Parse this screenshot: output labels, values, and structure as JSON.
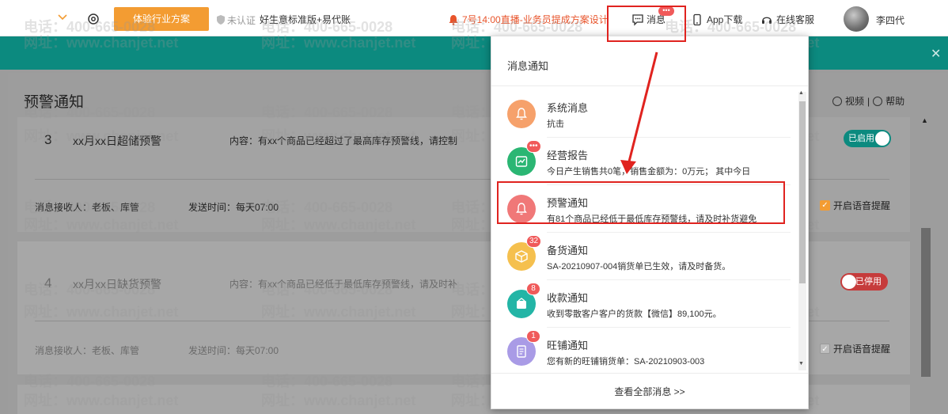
{
  "topbar": {
    "trial_button": "体验行业方案",
    "cert_label": "未认证",
    "edition": "好生意标准版+易代账",
    "live_notice": "7号14:00直播-业务员提成方案设计",
    "message_label": "消息",
    "message_badge": "•••",
    "app_label": "App下载",
    "service_label": "在线客服",
    "user_name": "李四代"
  },
  "page": {
    "title": "预警通知",
    "video_link": "视频",
    "help_link": "帮助"
  },
  "rules": [
    {
      "num": "3",
      "title": "xx月xx日超储预警",
      "content": "内容：有xx个商品已经超过了最高库存预警线，请控制",
      "receivers": "消息接收人：老板、库管",
      "send_time": "发送时间：每天07:00",
      "toggle": "已启用",
      "voice": "开启语音提醒"
    },
    {
      "num": "4",
      "title": "xx月xx日缺货预警",
      "content": "内容：有xx个商品已经低于最低库存预警线，请及时补",
      "receivers": "消息接收人：老板、库管",
      "send_time": "发送时间：每天07:00",
      "toggle": "已停用",
      "voice": "开启语音提醒"
    }
  ],
  "panel": {
    "title": "消息通知",
    "footer": "查看全部消息 >>",
    "items": [
      {
        "title": "系统消息",
        "desc": "抗击",
        "badge": "",
        "color": "#f6a16b",
        "icon": "bell-icon"
      },
      {
        "title": "经营报告",
        "desc": "今日产生销售共0笔，销售金额为：0万元； 其中今日",
        "badge": "•••",
        "color": "#2bb673",
        "icon": "report-icon"
      },
      {
        "title": "预警通知",
        "desc": "有81个商品已经低于最低库存预警线，请及时补货避免",
        "badge": "",
        "color": "#f07878",
        "icon": "bell-icon"
      },
      {
        "title": "备货通知",
        "desc": "SA-20210907-004销货单已生效，请及时备货。",
        "badge": "32",
        "color": "#f5c04e",
        "icon": "box-icon"
      },
      {
        "title": "收款通知",
        "desc": "收到零散客户客户的货款【微信】89,100元。",
        "badge": "8",
        "color": "#23b5a6",
        "icon": "wallet-icon"
      },
      {
        "title": "旺铺通知",
        "desc": "您有新的旺铺销货单：SA-20210903-003",
        "badge": "1",
        "color": "#a99be6",
        "icon": "document-icon"
      }
    ]
  },
  "watermark": {
    "phone": "电话：400-665-0028",
    "site": "网址：www.chanjet.net"
  },
  "colors": {
    "accent_orange": "#f39c32",
    "teal": "#0c8a7f",
    "alert_red": "#e0231f"
  }
}
